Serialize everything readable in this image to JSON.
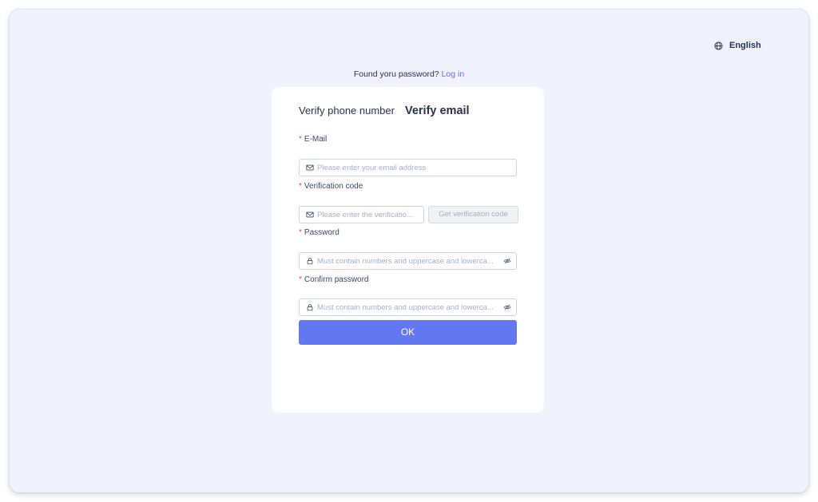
{
  "header": {
    "language_label": "English",
    "language_icon": "globe-icon"
  },
  "login_prompt": {
    "text": "Found yoru password?",
    "link_label": "Log in"
  },
  "tabs": [
    {
      "label": "Verify phone number",
      "active": false
    },
    {
      "label": "Verify email",
      "active": true
    }
  ],
  "form": {
    "required_mark": "*",
    "email": {
      "label": "E-Mail",
      "placeholder": "Please enter your email address",
      "value": "",
      "icon": "mail-icon"
    },
    "verification_code": {
      "label": "Verification code",
      "placeholder": "Please enter the verificatio...",
      "value": "",
      "icon": "mail-icon",
      "button_label": "Get verification code"
    },
    "password": {
      "label": "Password",
      "placeholder": "Must contain numbers and uppercase and lowerca...",
      "value": "",
      "icon": "lock-icon",
      "toggle_icon": "eye-off-icon"
    },
    "confirm_password": {
      "label": "Confirm password",
      "placeholder": "Must contain numbers and uppercase and lowerca...",
      "value": "",
      "icon": "lock-icon",
      "toggle_icon": "eye-off-icon"
    },
    "submit_label": "OK"
  },
  "colors": {
    "background": "#f0f3fe",
    "accent": "#6378f0",
    "link": "#5b72f2",
    "required": "#e5484d"
  }
}
